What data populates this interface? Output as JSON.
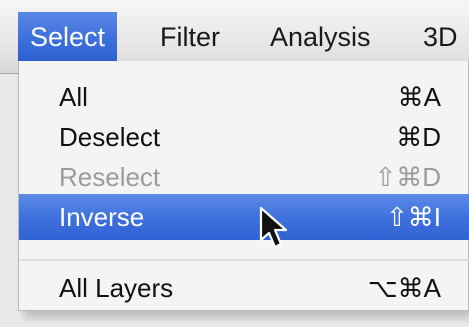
{
  "menubar": {
    "items": [
      {
        "label": "Select",
        "active": true
      },
      {
        "label": "Filter",
        "active": false
      },
      {
        "label": "Analysis",
        "active": false
      },
      {
        "label": "3D",
        "active": false
      }
    ]
  },
  "menu": {
    "items": [
      {
        "label": "All",
        "shortcut": "⌘A",
        "state": "enabled"
      },
      {
        "label": "Deselect",
        "shortcut": "⌘D",
        "state": "enabled"
      },
      {
        "label": "Reselect",
        "shortcut": "⇧⌘D",
        "state": "disabled"
      },
      {
        "label": "Inverse",
        "shortcut": "⇧⌘I",
        "state": "highlighted"
      },
      {
        "label": "All Layers",
        "shortcut": "⌥⌘A",
        "state": "enabled"
      }
    ]
  },
  "colors": {
    "highlight": "#3f72de",
    "disabled_text": "#9c9c9c"
  },
  "icons": {
    "cursor": "mouse-pointer-icon"
  }
}
